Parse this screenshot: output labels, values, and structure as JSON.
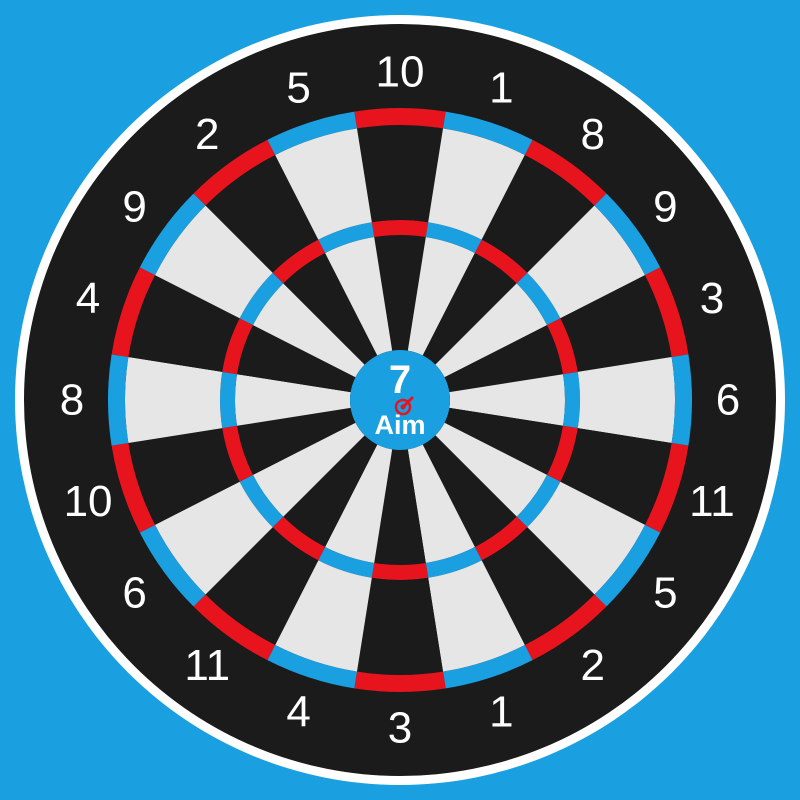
{
  "board": {
    "numbers_clockwise_from_top": [
      "10",
      "1",
      "8",
      "9",
      "3",
      "6",
      "11",
      "5",
      "2",
      "1",
      "3",
      "4",
      "11",
      "6",
      "10",
      "8",
      "4",
      "9",
      "2",
      "5"
    ],
    "bull": {
      "number": "7",
      "logo_text": "Aim"
    }
  },
  "colors": {
    "background": "#1a9fe0",
    "outer_rim": "#ffffff",
    "number_ring": "#1b1b1b",
    "segment_dark": "#1b1b1b",
    "segment_light": "#e6e6e6",
    "ring_red": "#e8141d",
    "ring_blue": "#1a9fe0",
    "bull_fill": "#1a9fe0",
    "number_text": "#ffffff"
  },
  "icons": {
    "bull_target": "dart-target-icon"
  }
}
